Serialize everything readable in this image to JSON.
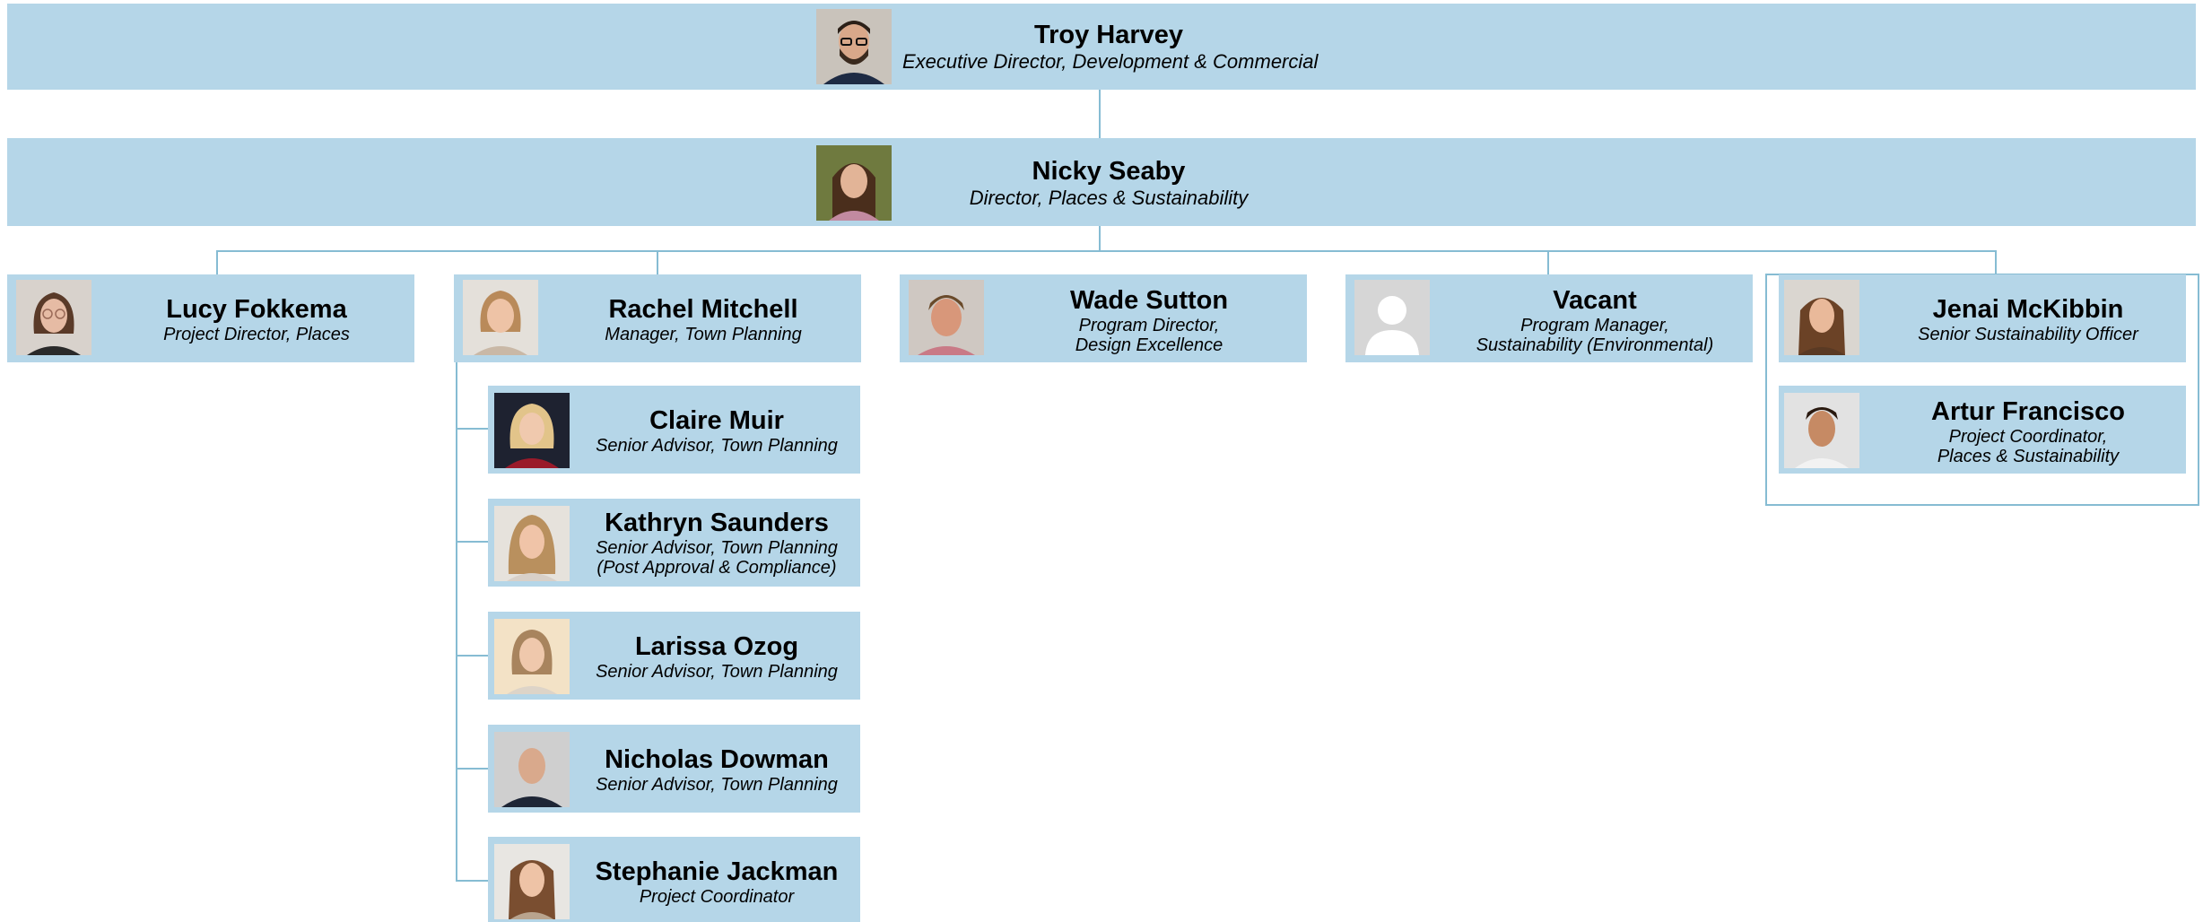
{
  "people": {
    "troy": {
      "name": "Troy Harvey",
      "title": "Executive Director, Development & Commercial"
    },
    "nicky": {
      "name": "Nicky Seaby",
      "title": "Director, Places & Sustainability"
    },
    "lucy": {
      "name": "Lucy Fokkema",
      "title": "Project Director, Places"
    },
    "rachel": {
      "name": "Rachel Mitchell",
      "title": "Manager, Town Planning"
    },
    "wade": {
      "name": "Wade Sutton",
      "title_line1": "Program Director,",
      "title_line2": "Design Excellence"
    },
    "vacant": {
      "name": "Vacant",
      "title_line1": "Program Manager,",
      "title_line2": "Sustainability (Environmental)"
    },
    "jenai": {
      "name": "Jenai McKibbin",
      "title": "Senior Sustainability Officer"
    },
    "artur": {
      "name": "Artur Francisco",
      "title_line1": "Project Coordinator,",
      "title_line2": "Places & Sustainability"
    },
    "claire": {
      "name": "Claire Muir",
      "title": "Senior Advisor, Town Planning"
    },
    "kathryn": {
      "name": "Kathryn Saunders",
      "title_line1": "Senior Advisor, Town Planning",
      "title_line2": "(Post Approval & Compliance)"
    },
    "larissa": {
      "name": "Larissa Ozog",
      "title": "Senior Advisor, Town Planning"
    },
    "nicholas": {
      "name": "Nicholas Dowman",
      "title": "Senior Advisor, Town Planning"
    },
    "stephanie": {
      "name": "Stephanie Jackman",
      "title": "Project Coordinator"
    }
  },
  "colors": {
    "box": "#b5d6e8",
    "connector": "#86bcd3"
  }
}
